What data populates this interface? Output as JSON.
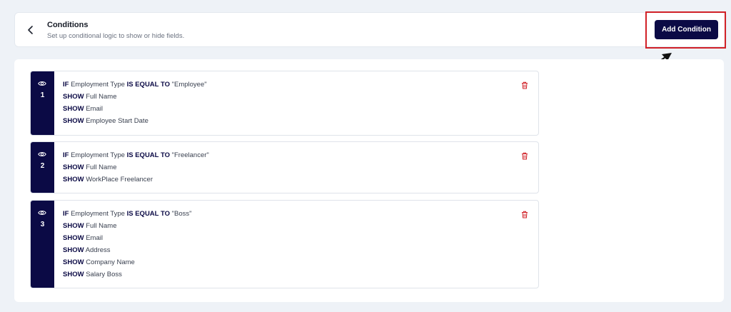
{
  "header": {
    "title": "Conditions",
    "subtitle": "Set up conditional logic to show or hide fields.",
    "add_button_label": "Add Condition"
  },
  "keywords": {
    "if": "IF",
    "equal": "IS EQUAL TO",
    "show": "SHOW"
  },
  "conditions": [
    {
      "number": "1",
      "field": "Employment Type",
      "value": "\"Employee\"",
      "shows": [
        "Full Name",
        "Email",
        "Employee Start Date"
      ]
    },
    {
      "number": "2",
      "field": "Employment Type",
      "value": "\"Freelancer\"",
      "shows": [
        "Full Name",
        "WorkPlace Freelancer"
      ]
    },
    {
      "number": "3",
      "field": "Employment Type",
      "value": "\"Boss\"",
      "shows": [
        "Full Name",
        "Email",
        "Address",
        "Company Name",
        "Salary Boss"
      ]
    }
  ],
  "colors": {
    "accent": "#0b0a45",
    "delete": "#d12127",
    "highlight": "#d12127"
  },
  "icons": {
    "back": "chevron-left-icon",
    "visibility": "eye-icon",
    "delete": "trash-icon"
  }
}
